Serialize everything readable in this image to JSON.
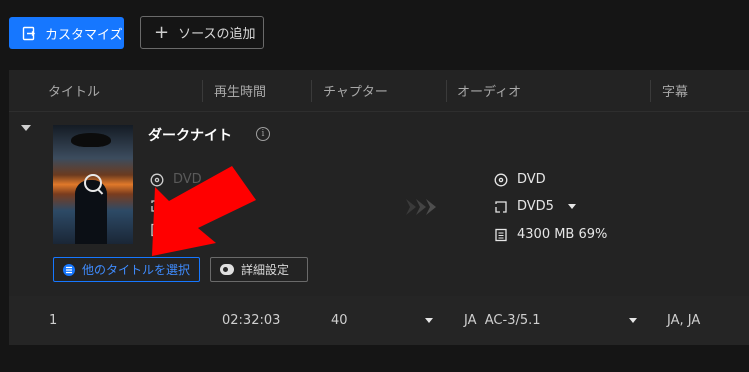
{
  "toolbar": {
    "customize_label": "カスタマイズ",
    "add_source_label": "ソースの追加"
  },
  "table": {
    "headers": [
      "タイトル",
      "再生時間",
      "チャプター",
      "オーディオ",
      "字幕"
    ]
  },
  "item": {
    "title": "ダークナイト",
    "source": {
      "type": "DVD"
    },
    "output": {
      "type": "DVD",
      "format": "DVD5",
      "size": "4300 MB 69%"
    },
    "select_other_title_label": "他のタイトルを選択",
    "advanced_settings_label": "詳細設定"
  },
  "row": {
    "index": "1",
    "duration": "02:32:03",
    "chapters": "40",
    "audio": "JA  AC-3/5.1",
    "subtitle": "JA, JA"
  },
  "colors": {
    "accent": "#1677ff",
    "background": "#151515",
    "panel": "#232323",
    "annotation_arrow": "#ff0000"
  }
}
